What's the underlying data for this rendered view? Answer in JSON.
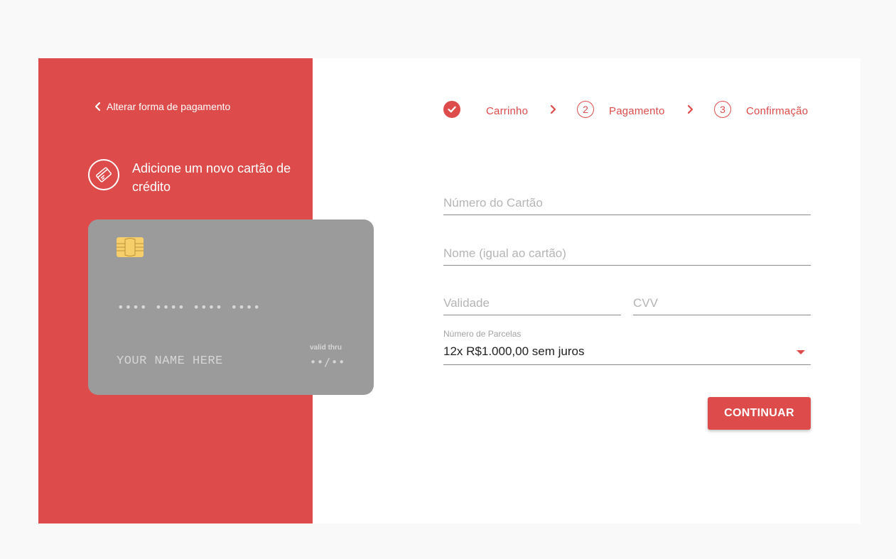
{
  "colors": {
    "accent": "#dd4b4b",
    "card_background": "#9b9b9b",
    "chip": "#f6cf6a",
    "page_background": "#f9f9f9"
  },
  "sidebar": {
    "back_link": {
      "label": "Alterar forma de pagamento",
      "icon": "chevron-left-icon"
    },
    "title": "Adicione um novo cartão de crédito",
    "title_icon": "credit-card-icon",
    "card_preview": {
      "number": "•••• •••• •••• ••••",
      "name": "YOUR NAME HERE",
      "valid_label": "valid thru",
      "valid_value": "••/••",
      "chip_icon": "card-chip-icon"
    }
  },
  "stepper": {
    "steps": [
      {
        "label": "Carrinho",
        "state": "done",
        "icon": "check-icon"
      },
      {
        "label": "Pagamento",
        "number": "2",
        "state": "pending"
      },
      {
        "label": "Confirmação",
        "number": "3",
        "state": "pending"
      }
    ],
    "separator_icon": "chevron-right-icon"
  },
  "form": {
    "card_number": {
      "placeholder": "Número do Cartão",
      "value": ""
    },
    "name": {
      "placeholder": "Nome (igual ao cartão)",
      "value": ""
    },
    "validity": {
      "placeholder": "Validade",
      "value": ""
    },
    "cvv": {
      "placeholder": "CVV",
      "value": ""
    },
    "installments": {
      "label": "Número de Parcelas",
      "selected": "12x R$1.000,00 sem juros",
      "icon": "dropdown-arrow-icon"
    },
    "submit_label": "CONTINUAR"
  }
}
